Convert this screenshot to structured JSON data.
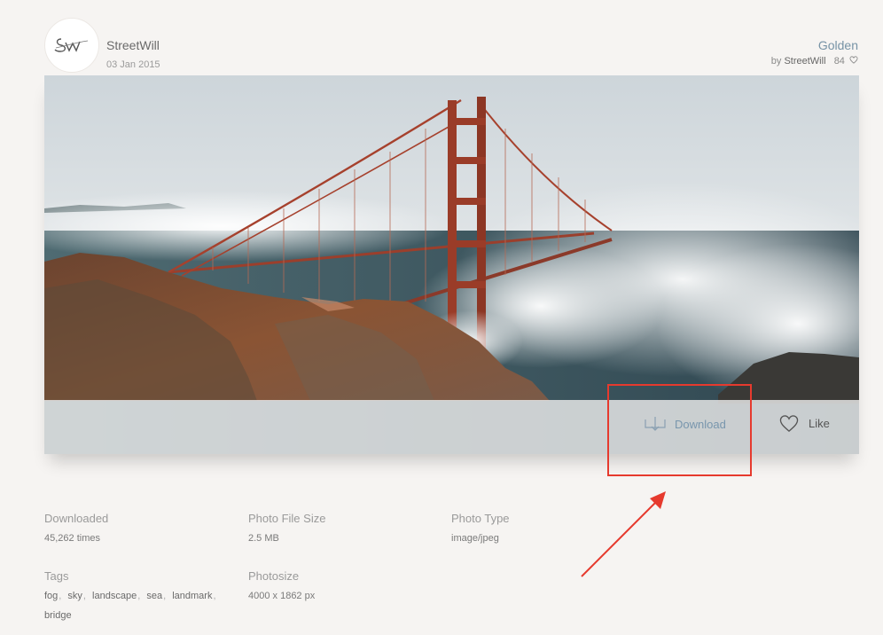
{
  "header": {
    "author_name": "StreetWill",
    "post_date": "03 Jan 2015",
    "photo_title": "Golden",
    "by_prefix": "by",
    "by_author": "StreetWill",
    "like_count": "84"
  },
  "photo": {
    "subject": "golden-gate-bridge-in-fog"
  },
  "actions": {
    "download_label": "Download",
    "like_label": "Like"
  },
  "meta": {
    "downloaded_label": "Downloaded",
    "downloaded_value": "45,262 times",
    "file_size_label": "Photo File Size",
    "file_size_value": "2.5 MB",
    "photo_type_label": "Photo Type",
    "photo_type_value": "image/jpeg",
    "tags_label": "Tags",
    "tags": [
      "fog",
      "sky",
      "landscape",
      "sea",
      "landmark",
      "bridge"
    ],
    "photosize_label": "Photosize",
    "photosize_value": "4000 x 1862 px"
  },
  "annotation": {
    "color": "#e63a2e"
  },
  "icons": {
    "logo": "streetwill-logo",
    "heart": "heart-icon",
    "download": "download-tray-icon"
  }
}
